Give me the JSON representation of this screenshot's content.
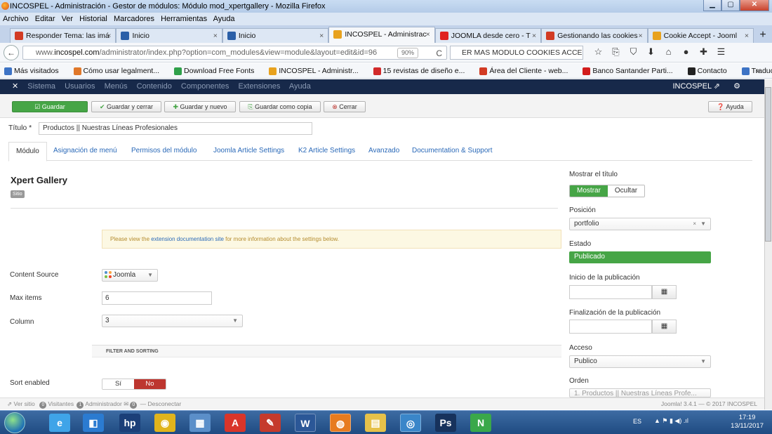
{
  "window": {
    "title": "INCOSPEL - Administración - Gestor de módulos: Módulo mod_xpertgallery - Mozilla Firefox",
    "controls": {
      "minimize": "▁",
      "maximize": "▢",
      "close": "✕"
    }
  },
  "menubar": [
    "Archivo",
    "Editar",
    "Ver",
    "Historial",
    "Marcadores",
    "Herramientas",
    "Ayuda"
  ],
  "tabs": [
    {
      "label": "Responder Tema: las imá",
      "color": "#d23b24"
    },
    {
      "label": "Inicio",
      "color": "#2a5fa8"
    },
    {
      "label": "Inicio",
      "color": "#2a5fa8"
    },
    {
      "label": "INCOSPEL - Administrac",
      "color": "#e8a21e"
    },
    {
      "label": "JOOMLA desde cero - T",
      "color": "#e02020"
    },
    {
      "label": "Gestionando las cookies",
      "color": "#d23b24"
    },
    {
      "label": "Cookie Accept - Jooml",
      "color": "#e8a21e"
    }
  ],
  "new_tab": "+",
  "nav": {
    "back": "←",
    "url_prefix": "www.",
    "url_host": "incospel.com",
    "url_path": "/administrator/index.php?option=com_modules&view=module&layout=edit&id=96",
    "zoom": "90%",
    "reload": "C",
    "search": "ER MAS MODULO COOKIES ACCEPT",
    "icons": [
      "☆",
      "⎘",
      "⛉",
      "⬇",
      "⌂",
      "●",
      "✚",
      "☰"
    ]
  },
  "bookmarks": [
    {
      "label": "Más visitados",
      "color": "#3d73c5"
    },
    {
      "label": "Cómo usar legalment...",
      "color": "#e0782a"
    },
    {
      "label": "Download Free Fonts",
      "color": "#2fa04a"
    },
    {
      "label": "INCOSPEL - Administr...",
      "color": "#e8a21e"
    },
    {
      "label": "15 revistas de diseño e...",
      "color": "#d22a2a"
    },
    {
      "label": "Área del Cliente - web...",
      "color": "#d23b24"
    },
    {
      "label": "Banco Santander Parti...",
      "color": "#d21c1c"
    },
    {
      "label": "Contacto",
      "color": "#222222"
    },
    {
      "label": "Traductor de Google",
      "color": "#3d73c5"
    }
  ],
  "bookmarks_more": "»",
  "joomla_nav": {
    "items": [
      "Sistema",
      "Usuarios",
      "Menús",
      "Contenido",
      "Componentes",
      "Extensiones",
      "Ayuda"
    ],
    "site_name": "INCOSPEL ⇗",
    "gear": "⚙"
  },
  "toolbar": {
    "save": "Guardar",
    "save_close": "Guardar y cerrar",
    "save_new": "Guardar y nuevo",
    "save_copy": "Guardar como copia",
    "close": "Cerrar",
    "help": "Ayuda"
  },
  "form": {
    "title_label": "Título *",
    "title_value": "Productos || Nuestras Líneas Profesionales"
  },
  "module_tabs": [
    "Módulo",
    "Asignación de menú",
    "Permisos del módulo",
    "Joomla Article Settings",
    "K2 Article Settings",
    "Avanzado",
    "Documentation & Support"
  ],
  "module": {
    "heading": "Xpert Gallery",
    "badge": "Sitio",
    "alert_pre": "Please view the ",
    "alert_link": "extension documentation site",
    "alert_post": " for more information about the settings below.",
    "content_source_label": "Content Source",
    "content_source_value": "Joomla",
    "max_items_label": "Max items",
    "max_items_value": "6",
    "column_label": "Column",
    "column_value": "3",
    "filter_header": "FILTER AND SORTING",
    "sort_label": "Sort enabled",
    "sort_yes": "Sí",
    "sort_no": "No"
  },
  "sidebar": {
    "show_title_label": "Mostrar el título",
    "show": "Mostrar",
    "hide": "Ocultar",
    "position_label": "Posición",
    "position_value": "portfolio",
    "state_label": "Estado",
    "state_value": "Publicado",
    "start_label": "Inicio de la publicación",
    "end_label": "Finalización de la publicación",
    "access_label": "Acceso",
    "access_value": "Publico",
    "order_label": "Orden",
    "order_value": "1. Productos || Nuestras Líneas Profe..."
  },
  "statusbar": {
    "view_site": "Ver sitio",
    "visitors_count": "0",
    "visitors": "Visitantes",
    "admins_count": "1",
    "admins": "Administrador",
    "messages_count": "0",
    "logout": "Desconectar",
    "version": "Joomla! 3.4.1 — © 2017 INCOSPEL"
  },
  "taskbar": {
    "lang": "ES",
    "time": "17:19",
    "date": "13/11/2017",
    "apps": [
      {
        "glyph": "e",
        "color": "#3fa4e8"
      },
      {
        "glyph": "◧",
        "color": "#2b7bd1"
      },
      {
        "glyph": "hp",
        "color": "#1b3f78"
      },
      {
        "glyph": "◉",
        "color": "#e0b41c"
      },
      {
        "glyph": "▦",
        "color": "#5b8fc9"
      },
      {
        "glyph": "A",
        "color": "#d9352a"
      },
      {
        "glyph": "✎",
        "color": "#c53a2c"
      },
      {
        "glyph": "W",
        "color": "#2b5797"
      },
      {
        "glyph": "◍",
        "color": "#e77b1f"
      },
      {
        "glyph": "▤",
        "color": "#e6c14a"
      },
      {
        "glyph": "◎",
        "color": "#3a86c9"
      },
      {
        "glyph": "Ps",
        "color": "#17325c"
      },
      {
        "glyph": "N",
        "color": "#3aa84a"
      }
    ]
  }
}
